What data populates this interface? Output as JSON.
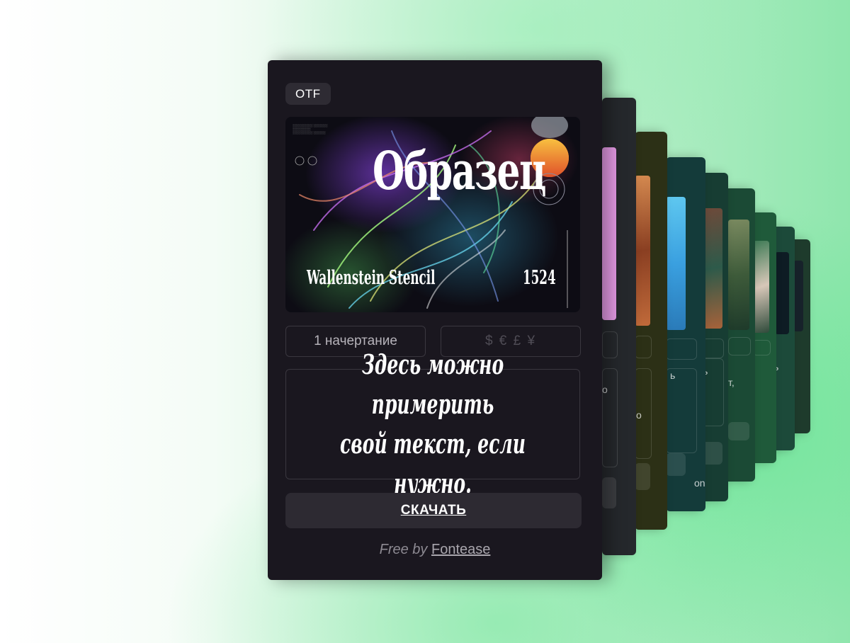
{
  "card": {
    "format_badge": "OTF",
    "preview": {
      "headline": "Образец",
      "font_name": "Wallenstein Stencil",
      "year": "1524"
    },
    "styles_count": "1 начертание",
    "price_symbols": "$ € £ ¥",
    "sample_text": "Здесь можно примерить\nсвой текст, если нужно.",
    "download_label": "СКАЧАТЬ",
    "credit_prefix": "Free by",
    "credit_link": "Fontease"
  },
  "stack_fragments": [
    "о",
    "ь",
    "о",
    "ь",
    "т,",
    "ь",
    "on"
  ],
  "colors": {
    "card_bg": "#1a171f",
    "badge_bg": "#2e2b33",
    "button_bg": "#2d2a32",
    "accent_green": "#62e491"
  }
}
